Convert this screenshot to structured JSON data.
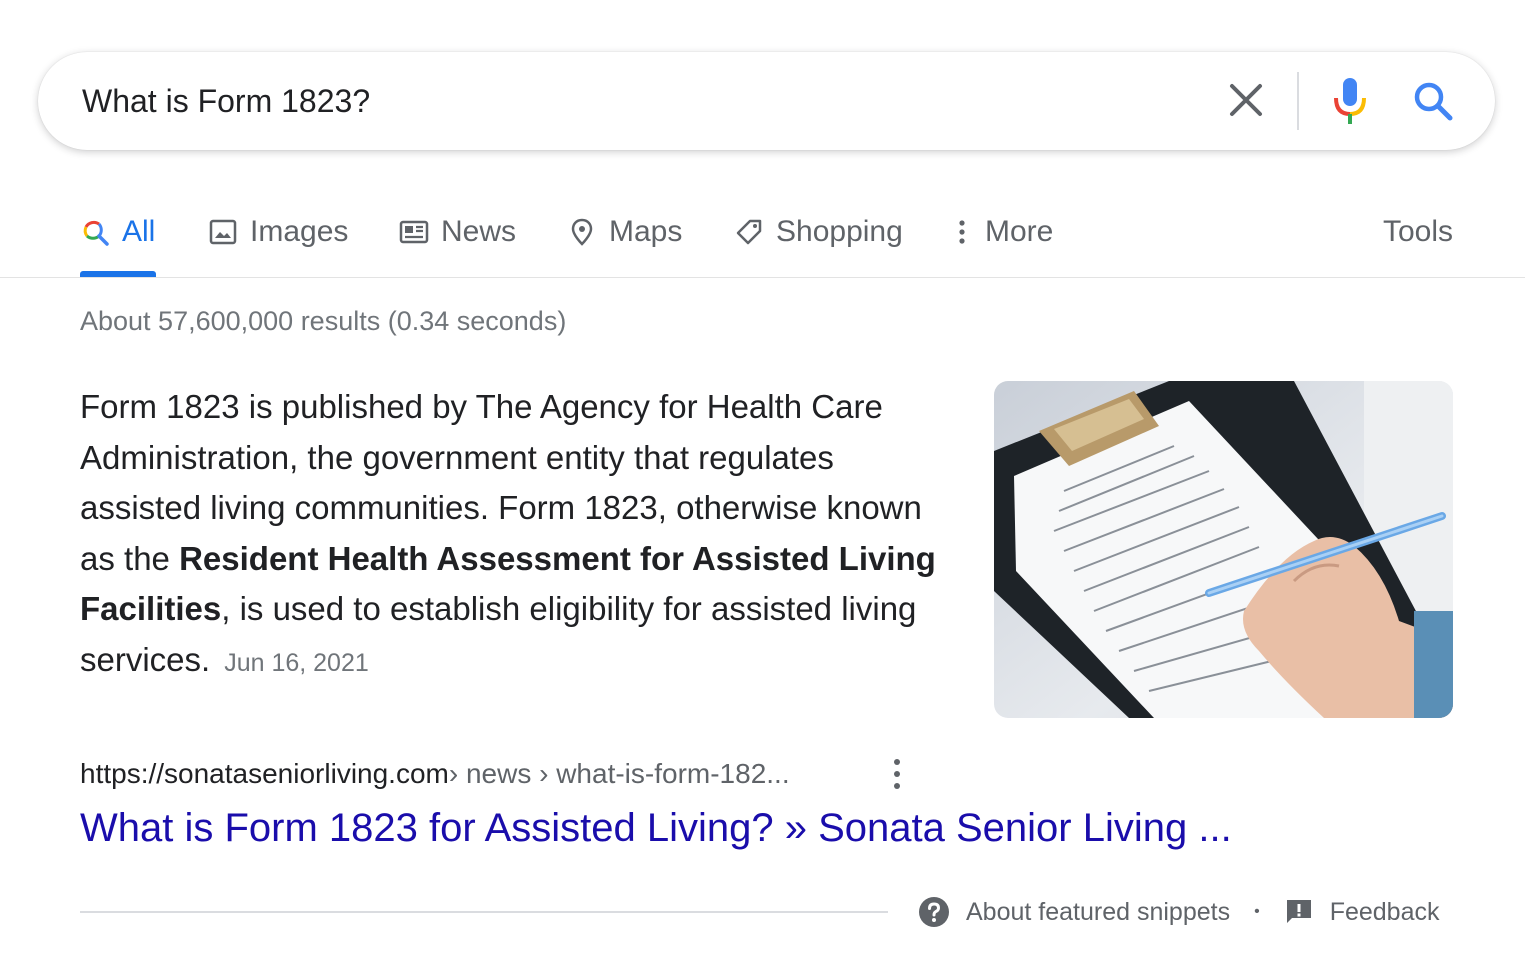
{
  "search": {
    "query": "What is Form 1823?",
    "clear_icon": "close-icon",
    "voice_icon": "microphone-icon",
    "search_icon": "search-icon"
  },
  "tabs": [
    {
      "label": "All",
      "icon": "search-icon",
      "active": true
    },
    {
      "label": "Images",
      "icon": "image-icon",
      "active": false
    },
    {
      "label": "News",
      "icon": "newspaper-icon",
      "active": false
    },
    {
      "label": "Maps",
      "icon": "map-pin-icon",
      "active": false
    },
    {
      "label": "Shopping",
      "icon": "tag-icon",
      "active": false
    },
    {
      "label": "More",
      "icon": "more-vert-icon",
      "active": false
    }
  ],
  "tools_label": "Tools",
  "result_stats": "About 57,600,000 results (0.34 seconds)",
  "snippet": {
    "text_before": "Form 1823 is published by The Agency for Health Care Administration, the government entity that regulates assisted living communities. Form 1823, otherwise known as the ",
    "bold": "Resident Health Assessment for Assisted Living Facilities",
    "text_after": ", is used to establish eligibility for assisted living services.",
    "date": "Jun 16, 2021",
    "image_icon": "clipboard-form-photo"
  },
  "result": {
    "site": "https://sonataseniorliving.com",
    "path": " › news › what-is-form-182...",
    "title": "What is Form 1823 for Assisted Living? » Sonata Senior Living ..."
  },
  "footer": {
    "about_label": "About featured snippets",
    "separator": "•",
    "feedback_label": "Feedback"
  },
  "colors": {
    "accent": "#1a73e8",
    "link": "#1a0dab",
    "muted": "#70757a"
  }
}
